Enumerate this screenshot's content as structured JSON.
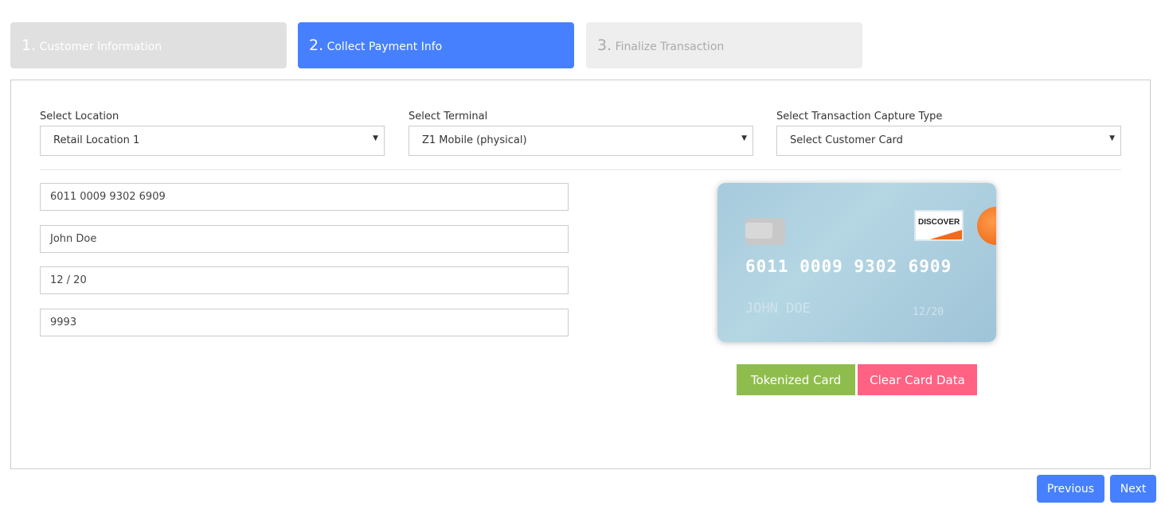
{
  "steps": [
    {
      "num": "1.",
      "label": "Customer Information"
    },
    {
      "num": "2.",
      "label": "Collect Payment Info"
    },
    {
      "num": "3.",
      "label": "Finalize Transaction"
    }
  ],
  "form": {
    "location_label": "Select Location",
    "location_value": "Retail Location 1",
    "terminal_label": "Select Terminal",
    "terminal_value": "Z1 Mobile (physical)",
    "capture_label": "Select Transaction Capture Type",
    "capture_value": "Select Customer Card"
  },
  "card_fields": {
    "number": "6011 0009 9302 6909",
    "name": "John Doe",
    "expiry": "12 / 20",
    "cvv": "9993"
  },
  "card_preview": {
    "brand": "DISCOVER",
    "number": "6011 0009 9302 6909",
    "name": "JOHN DOE",
    "expiry": "12/20"
  },
  "buttons": {
    "tokenized": "Tokenized Card",
    "clear": "Clear Card Data",
    "previous": "Previous",
    "next": "Next"
  },
  "colors": {
    "active_step": "#4680ff",
    "tokenized": "#8fbd4d",
    "clear": "#ff6283"
  }
}
